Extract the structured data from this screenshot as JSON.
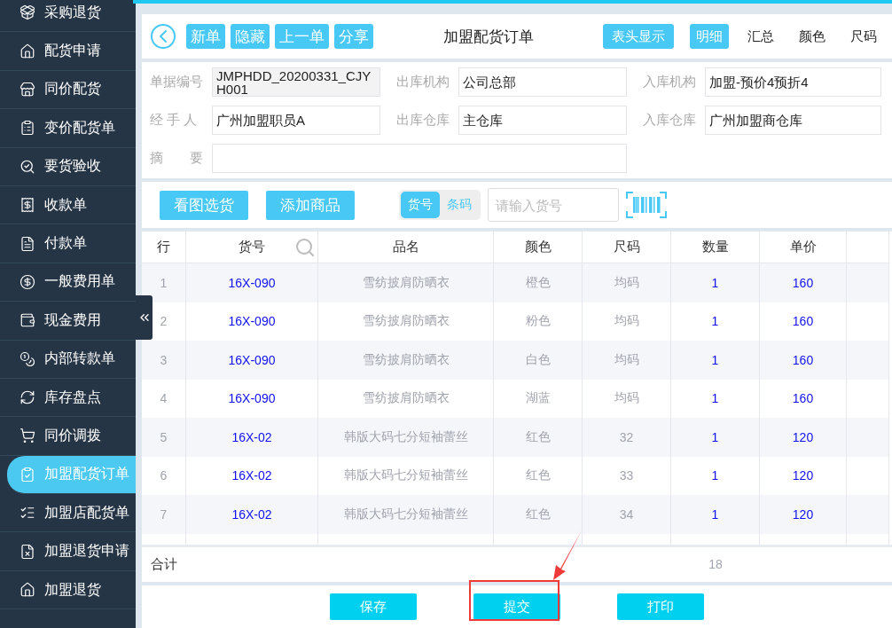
{
  "sidebar": {
    "items": [
      {
        "label": "采购退货",
        "selected": false
      },
      {
        "label": "配货申请",
        "selected": false
      },
      {
        "label": "同价配货",
        "selected": false
      },
      {
        "label": "变价配货单",
        "selected": false
      },
      {
        "label": "要货验收",
        "selected": false
      },
      {
        "label": "收款单",
        "selected": false
      },
      {
        "label": "付款单",
        "selected": false
      },
      {
        "label": "一般费用单",
        "selected": false
      },
      {
        "label": "现金费用",
        "selected": false
      },
      {
        "label": "内部转款单",
        "selected": false
      },
      {
        "label": "库存盘点",
        "selected": false
      },
      {
        "label": "同价调拨",
        "selected": false
      },
      {
        "label": "加盟配货订单",
        "selected": true
      },
      {
        "label": "加盟店配货单",
        "selected": false
      },
      {
        "label": "加盟退货申请",
        "selected": false
      },
      {
        "label": "加盟退货",
        "selected": false
      }
    ]
  },
  "toolbar": {
    "buttons": [
      "新单",
      "隐藏",
      "上一单",
      "分享"
    ],
    "title": "加盟配货订单",
    "header_toggle": "表头显示",
    "views": [
      {
        "label": "明细",
        "selected": true
      },
      {
        "label": "汇总",
        "selected": false
      },
      {
        "label": "颜色",
        "selected": false
      },
      {
        "label": "尺码",
        "selected": false
      }
    ]
  },
  "form": {
    "fields": [
      {
        "label": "单据编号",
        "value": "JMPHDD_20200331_CJYH001",
        "readonly": true
      },
      {
        "label": "出库机构",
        "value": "公司总部",
        "readonly": false
      },
      {
        "label": "入库机构",
        "value": "加盟-预价4预折4",
        "readonly": false
      },
      {
        "label": "经 手 人",
        "value": "广州加盟职员A",
        "readonly": false
      },
      {
        "label": "出库仓库",
        "value": "主仓库",
        "readonly": false
      },
      {
        "label": "入库仓库",
        "value": "广州加盟商仓库",
        "readonly": false
      },
      {
        "label": "摘　　要",
        "readonly": false
      }
    ]
  },
  "actions": {
    "buttons": [
      "看图选货",
      "添加商品"
    ],
    "modes": [
      {
        "label": "货号",
        "selected": true
      },
      {
        "label": "条码",
        "selected": false
      }
    ],
    "search": {
      "placeholder": "请输入货号"
    }
  },
  "table": {
    "columns": [
      "行",
      "货号",
      "品名",
      "颜色",
      "尺码",
      "数量",
      "单价"
    ],
    "rows": [
      {
        "row": "1",
        "code": "16X-090",
        "name": "雪纺披肩防晒衣",
        "color_name": "橙色",
        "size": "均码",
        "qty": "1",
        "price": "160"
      },
      {
        "row": "2",
        "code": "16X-090",
        "name": "雪纺披肩防晒衣",
        "color_name": "粉色",
        "size": "均码",
        "qty": "1",
        "price": "160"
      },
      {
        "row": "3",
        "code": "16X-090",
        "name": "雪纺披肩防晒衣",
        "color_name": "白色",
        "size": "均码",
        "qty": "1",
        "price": "160"
      },
      {
        "row": "4",
        "code": "16X-090",
        "name": "雪纺披肩防晒衣",
        "color_name": "湖蓝",
        "size": "均码",
        "qty": "1",
        "price": "160"
      },
      {
        "row": "5",
        "code": "16X-02",
        "name": "韩版大码七分短袖蕾丝",
        "color_name": "红色",
        "size": "32",
        "qty": "1",
        "price": "120"
      },
      {
        "row": "6",
        "code": "16X-02",
        "name": "韩版大码七分短袖蕾丝",
        "color_name": "红色",
        "size": "33",
        "qty": "1",
        "price": "120"
      },
      {
        "row": "7",
        "code": "16X-02",
        "name": "韩版大码七分短袖蕾丝",
        "color_name": "红色",
        "size": "34",
        "qty": "1",
        "price": "120"
      }
    ],
    "total": {
      "label": "合计",
      "qty": "18"
    }
  },
  "footer": {
    "buttons": [
      {
        "label": "保存",
        "highlighted": false
      },
      {
        "label": "提交",
        "highlighted": true
      },
      {
        "label": "打印",
        "highlighted": false
      }
    ]
  }
}
